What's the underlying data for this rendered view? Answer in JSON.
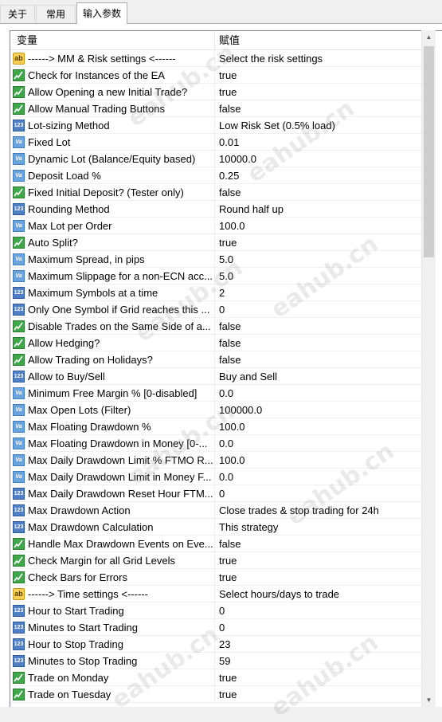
{
  "tabs": [
    {
      "label": "关于",
      "active": false
    },
    {
      "label": "常用",
      "active": false
    },
    {
      "label": "输入参数",
      "active": true
    }
  ],
  "table": {
    "header_variable": "变量",
    "header_value": "赋值",
    "rows": [
      {
        "icon": "string",
        "name": "------> MM & Risk settings <------",
        "value": "Select the risk settings"
      },
      {
        "icon": "bool",
        "name": "Check for Instances of the EA",
        "value": "true"
      },
      {
        "icon": "bool",
        "name": "Allow Opening a new Initial Trade?",
        "value": "true"
      },
      {
        "icon": "bool",
        "name": "Allow Manual Trading Buttons",
        "value": "false"
      },
      {
        "icon": "enum",
        "name": "Lot-sizing Method",
        "value": "Low Risk Set (0.5% load)"
      },
      {
        "icon": "double",
        "name": "Fixed Lot",
        "value": "0.01"
      },
      {
        "icon": "double",
        "name": "Dynamic Lot (Balance/Equity based)",
        "value": "10000.0"
      },
      {
        "icon": "double",
        "name": "Deposit Load %",
        "value": "0.25"
      },
      {
        "icon": "bool",
        "name": "Fixed Initial Deposit? (Tester only)",
        "value": "false"
      },
      {
        "icon": "enum",
        "name": "Rounding Method",
        "value": "Round half up"
      },
      {
        "icon": "double",
        "name": "Max Lot per Order",
        "value": "100.0"
      },
      {
        "icon": "bool",
        "name": "Auto Split?",
        "value": "true"
      },
      {
        "icon": "double",
        "name": "Maximum Spread, in pips",
        "value": "5.0"
      },
      {
        "icon": "double",
        "name": "Maximum Slippage for a non-ECN acc...",
        "value": "5.0"
      },
      {
        "icon": "enum",
        "name": "Maximum Symbols at a time",
        "value": "2"
      },
      {
        "icon": "enum",
        "name": "Only One Symbol if Grid reaches this ...",
        "value": "0"
      },
      {
        "icon": "bool",
        "name": "Disable Trades on the Same Side of a...",
        "value": "false"
      },
      {
        "icon": "bool",
        "name": "Allow Hedging?",
        "value": "false"
      },
      {
        "icon": "bool",
        "name": "Allow Trading on Holidays?",
        "value": "false"
      },
      {
        "icon": "enum",
        "name": "Allow to Buy/Sell",
        "value": "Buy and Sell"
      },
      {
        "icon": "double",
        "name": "Minimum Free Margin % [0-disabled]",
        "value": "0.0"
      },
      {
        "icon": "double",
        "name": "Max Open Lots (Filter)",
        "value": "100000.0"
      },
      {
        "icon": "double",
        "name": "Max Floating Drawdown %",
        "value": "100.0"
      },
      {
        "icon": "double",
        "name": "Max Floating Drawdown in Money [0-...",
        "value": "0.0"
      },
      {
        "icon": "double",
        "name": "Max Daily Drawdown Limit % FTMO R...",
        "value": "100.0"
      },
      {
        "icon": "double",
        "name": "Max Daily Drawdown Limit in Money F...",
        "value": "0.0"
      },
      {
        "icon": "enum",
        "name": "Max Daily Drawdown Reset Hour FTM...",
        "value": "0"
      },
      {
        "icon": "enum",
        "name": "Max Drawdown Action",
        "value": "Close trades & stop trading for 24h"
      },
      {
        "icon": "enum",
        "name": "Max Drawdown Calculation",
        "value": "This strategy"
      },
      {
        "icon": "bool",
        "name": "Handle Max Drawdown Events on Eve...",
        "value": "false"
      },
      {
        "icon": "bool",
        "name": "Check Margin for all Grid Levels",
        "value": "true"
      },
      {
        "icon": "bool",
        "name": "Check Bars for Errors",
        "value": "true"
      },
      {
        "icon": "string",
        "name": "------> Time settings <------",
        "value": "Select hours/days to trade"
      },
      {
        "icon": "enum",
        "name": "Hour to Start Trading",
        "value": "0"
      },
      {
        "icon": "enum",
        "name": "Minutes to Start Trading",
        "value": "0"
      },
      {
        "icon": "enum",
        "name": "Hour to Stop Trading",
        "value": "23"
      },
      {
        "icon": "enum",
        "name": "Minutes to Stop Trading",
        "value": "59"
      },
      {
        "icon": "bool",
        "name": "Trade on Monday",
        "value": "true"
      },
      {
        "icon": "bool",
        "name": "Trade on Tuesday",
        "value": "true"
      }
    ]
  },
  "icon_labels": {
    "string": "ab",
    "enum": "123",
    "double": "Va"
  },
  "watermark": "eahub.cn"
}
